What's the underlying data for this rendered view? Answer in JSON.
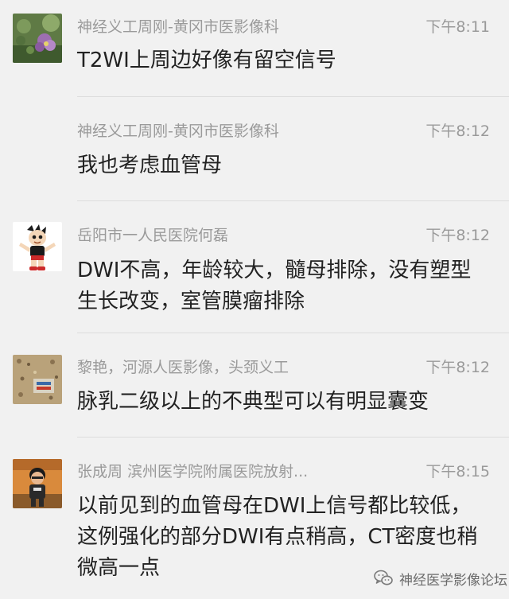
{
  "messages": [
    {
      "sender": "神经义工周刚-黄冈市医影像科",
      "time": "下午8:11",
      "text": "T2WI上周边好像有留空信号",
      "avatar": "flower-photo-avatar"
    },
    {
      "sender": "神经义工周刚-黄冈市医影像科",
      "time": "下午8:12",
      "text": "我也考虑血管母"
    },
    {
      "sender": "岳阳市一人民医院何磊",
      "time": "下午8:12",
      "text": "DWI不高，年龄较大，髓母排除，没有塑型生长改变，室管膜瘤排除",
      "avatar": "cartoon-robot-avatar"
    },
    {
      "sender": "黎艳，河源人医影像，头颈义工",
      "time": "下午8:12",
      "text": "脉乳二级以上的不典型可以有明显囊变",
      "avatar": "painting-photo-avatar"
    },
    {
      "sender": "张成周 滨州医学院附属医院放射...",
      "time": "下午8:15",
      "text": "以前见到的血管母在DWI上信号都比较低，这例强化的部分DWI有点稍高，CT密度也稍微高一点",
      "avatar": "child-photo-avatar"
    }
  ],
  "watermark": {
    "text": "神经医学影像论坛",
    "icon": "wechat-chat-icon"
  }
}
